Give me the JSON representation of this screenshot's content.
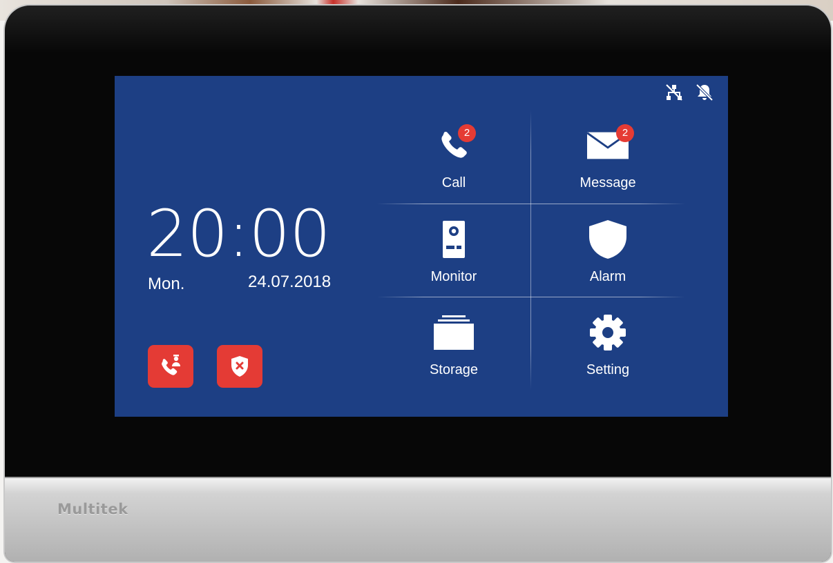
{
  "colors": {
    "screen_bg": "#1d3f84",
    "accent_red": "#e43b35",
    "text": "#ffffff"
  },
  "brand": "Multitek",
  "status_icons": [
    "network-icon",
    "bell-muted-icon"
  ],
  "clock": {
    "time": "20:00",
    "day": "Mon.",
    "date": "24.07.2018"
  },
  "quick_buttons": [
    {
      "icon": "call-guard-icon",
      "action": "call-guard"
    },
    {
      "icon": "shield-cancel-icon",
      "action": "cancel-alarm"
    }
  ],
  "menu": [
    {
      "label": "Call",
      "icon": "phone-icon",
      "badge": "2"
    },
    {
      "label": "Message",
      "icon": "envelope-icon",
      "badge": "2"
    },
    {
      "label": "Monitor",
      "icon": "door-station-icon"
    },
    {
      "label": "Alarm",
      "icon": "shield-icon"
    },
    {
      "label": "Storage",
      "icon": "folder-icon"
    },
    {
      "label": "Setting",
      "icon": "gear-icon"
    }
  ]
}
